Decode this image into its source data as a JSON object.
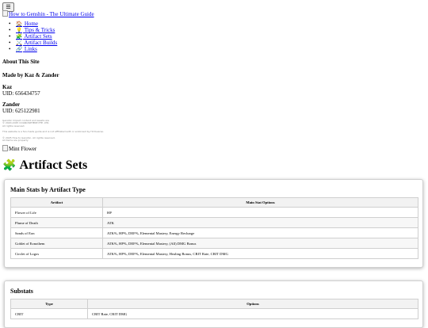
{
  "header": {
    "menu_icon": "☰",
    "logo_alt": "How to Genshin - The Ultimate Guide"
  },
  "nav": {
    "items": [
      {
        "icon": "🏠",
        "label": "Home"
      },
      {
        "icon": "💡",
        "label": "Tips & Tricks"
      },
      {
        "icon": "🧩",
        "label": "Artifact Sets"
      },
      {
        "icon": "⚔️",
        "label": "Artifact Builds"
      },
      {
        "icon": "🔗",
        "label": "Links"
      }
    ]
  },
  "sidebar": {
    "about_title": "About This Site",
    "made_by": "Made by Kaz & Zander",
    "people": [
      {
        "name": "Kaz",
        "uid": "UID: 656434757"
      },
      {
        "name": "Zander",
        "uid": "UID: 625122981"
      }
    ],
    "fine_print": [
      "Genshin Impact content and assets are",
      "© 2020-2025 COGNOSPHERE PTE. LTD.",
      "All rights reserved.",
      "This website is a fan-made guide and is not affiliated with or endorsed by HoYoverse.",
      "© 2025 How to Genshin. All rights reserved.",
      "All items are property"
    ],
    "image_alt": "Mint Flower"
  },
  "main": {
    "title_icon": "🧩",
    "title": "Artifact Sets",
    "main_stats": {
      "heading": "Main Stats by Artifact Type",
      "columns": [
        "Artifact",
        "Main Stat Options"
      ],
      "rows": [
        [
          "Flower of Life",
          "HP"
        ],
        [
          "Plume of Death",
          "ATK"
        ],
        [
          "Sands of Eon",
          "ATK%, HP%, DEF%, Elemental Mastery, Energy Recharge"
        ],
        [
          "Goblet of Eonothem",
          "ATK%, HP%, DEF%, Elemental Mastery, (All) DMG Bonus"
        ],
        [
          "Circlet of Logos",
          "ATK%, HP%, DEF%, Elemental Mastery, Healing Bonus, CRIT Rate, CRIT DMG"
        ]
      ]
    },
    "substats": {
      "heading": "Substats",
      "columns": [
        "Type",
        "Options"
      ],
      "rows": [
        [
          "CRIT",
          "CRIT Rate, CRIT DMG"
        ]
      ]
    }
  }
}
